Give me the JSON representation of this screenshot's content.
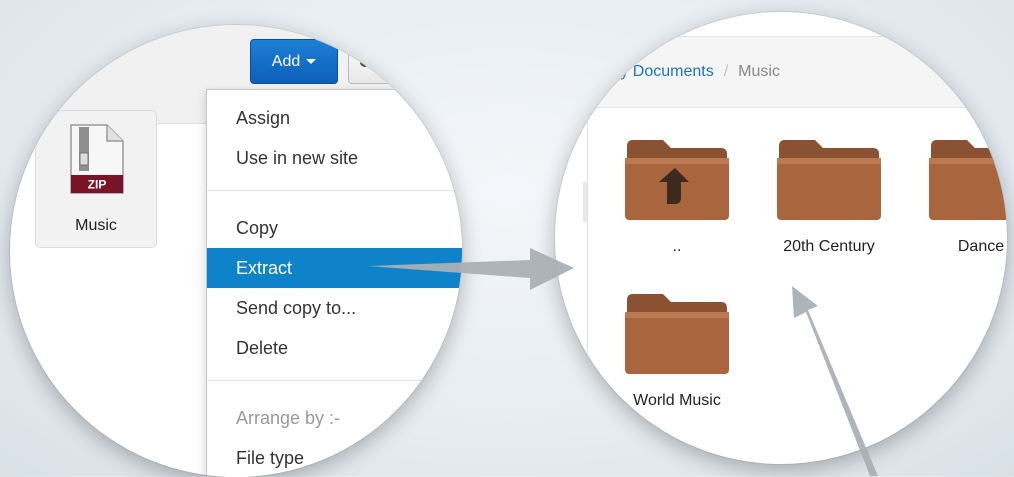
{
  "toolbar": {
    "add_label": "Add",
    "second_button_icon": "gear-icon"
  },
  "file": {
    "badge": "ZIP",
    "name": "Music"
  },
  "menu": {
    "items": [
      {
        "label": "Assign"
      },
      {
        "label": "Use in new site"
      },
      {
        "label": "Copy"
      },
      {
        "label": "Extract",
        "active": true
      },
      {
        "label": "Send copy to..."
      },
      {
        "label": "Delete"
      },
      {
        "label": "Arrange by :-",
        "header": true
      },
      {
        "label": "File type"
      }
    ]
  },
  "breadcrumb": {
    "parent": "My Documents",
    "separator": "/",
    "current": "Music"
  },
  "folders": [
    {
      "label": "..",
      "icon": "folder-up-icon"
    },
    {
      "label": "20th Century",
      "icon": "folder-icon"
    },
    {
      "label": "Dance",
      "icon": "folder-icon"
    },
    {
      "label": "World Music",
      "icon": "folder-icon"
    }
  ],
  "colors": {
    "accent": "#0e83c9",
    "button": "#1570c9",
    "folder": "#a0603a",
    "arrow": "#a8b0b7"
  }
}
